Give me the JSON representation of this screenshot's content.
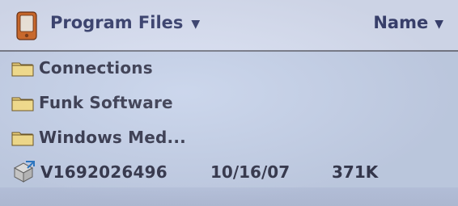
{
  "header": {
    "folder_title": "Program Files",
    "sort_label": "Name",
    "device_icon": "pocket-pc-icon",
    "dropdown_icon": "caret-down-icon"
  },
  "list": {
    "items": [
      {
        "type": "folder",
        "icon": "folder-icon",
        "name": "Connections",
        "date": "",
        "size": ""
      },
      {
        "type": "folder",
        "icon": "folder-icon",
        "name": "Funk Software",
        "date": "",
        "size": ""
      },
      {
        "type": "folder",
        "icon": "folder-icon",
        "name": "Windows Med...",
        "date": "",
        "size": ""
      },
      {
        "type": "file",
        "icon": "setup-package-icon",
        "name": "V1692026496",
        "date": "10/16/07",
        "size": "371K"
      }
    ]
  },
  "colors": {
    "background": "#c6d2ea",
    "header_background": "#d9e0f3",
    "text": "#36384e",
    "header_text": "#3a4270",
    "divider": "#777a88"
  }
}
